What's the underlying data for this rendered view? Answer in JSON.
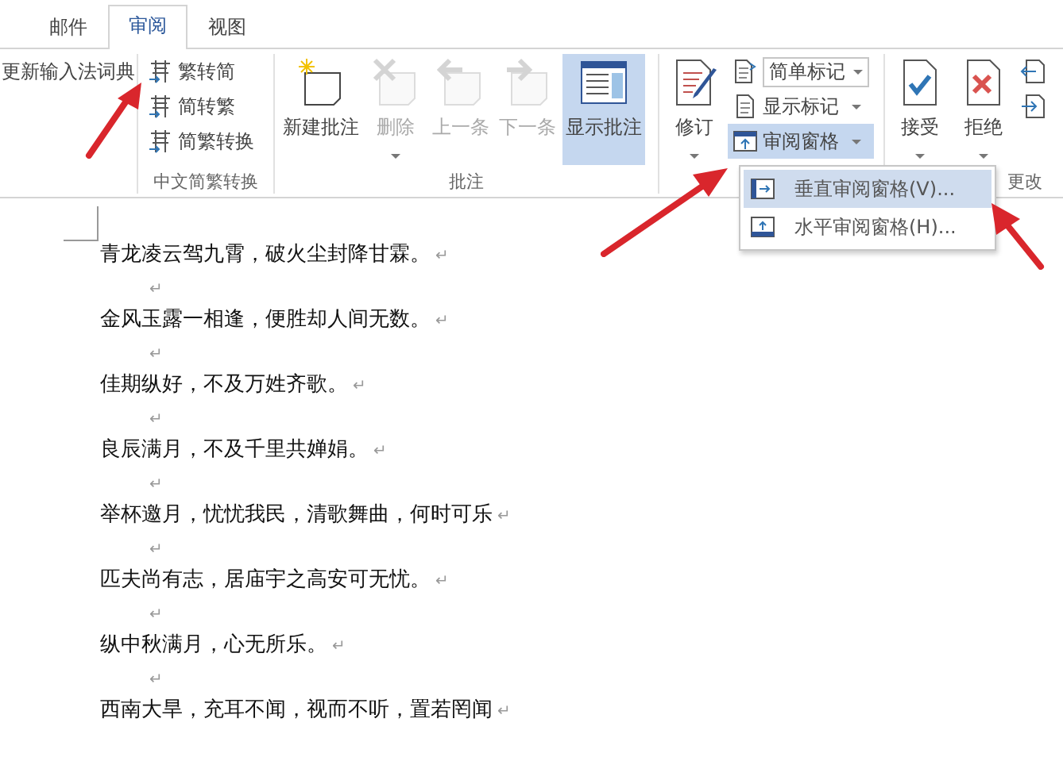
{
  "tabs": [
    {
      "label": "邮件",
      "selected": false
    },
    {
      "label": "审阅",
      "selected": true
    },
    {
      "label": "视图",
      "selected": false
    }
  ],
  "ribbon": {
    "groups": [
      {
        "items": [
          {
            "kind": "small",
            "label": "更新输入法词典",
            "disabled": false,
            "selected": false
          }
        ]
      },
      {
        "label": "中文简繁转换",
        "items": [
          {
            "kind": "small",
            "label": "繁转简",
            "disabled": false,
            "selected": false
          },
          {
            "kind": "small",
            "label": "简转繁",
            "disabled": false,
            "selected": false
          },
          {
            "kind": "small",
            "label": "简繁转换",
            "disabled": false,
            "selected": false
          }
        ]
      },
      {
        "label": "批注",
        "items": [
          {
            "kind": "large",
            "label": "新建批注",
            "disabled": false,
            "selected": false
          },
          {
            "kind": "large",
            "label": "删除",
            "disabled": true,
            "selected": false,
            "dropdown": true
          },
          {
            "kind": "large",
            "label": "上一条",
            "disabled": true,
            "selected": false
          },
          {
            "kind": "large",
            "label": "下一条",
            "disabled": true,
            "selected": false
          },
          {
            "kind": "large",
            "label": "显示批注",
            "disabled": false,
            "selected": true
          }
        ]
      },
      {
        "items": [
          {
            "kind": "large",
            "label": "修订",
            "disabled": false,
            "selected": false,
            "dropdown": true
          },
          {
            "kind": "combo",
            "label": "简单标记",
            "dropdown": true
          },
          {
            "kind": "small",
            "label": "显示标记",
            "disabled": false,
            "selected": false,
            "dropdown": true
          },
          {
            "kind": "small",
            "label": "审阅窗格",
            "disabled": false,
            "selected": true,
            "dropdown": true
          }
        ]
      },
      {
        "label": "更改",
        "items": [
          {
            "kind": "large",
            "label": "接受",
            "disabled": false,
            "selected": false,
            "dropdown": true
          },
          {
            "kind": "large",
            "label": "拒绝",
            "disabled": false,
            "selected": false,
            "dropdown": true
          },
          {
            "kind": "icon",
            "disabled": false,
            "selected": false
          },
          {
            "kind": "icon",
            "disabled": false,
            "selected": false
          }
        ]
      }
    ]
  },
  "menu": {
    "items": [
      {
        "label": "垂直审阅窗格(V)...",
        "selected": true
      },
      {
        "label": "水平审阅窗格(H)...",
        "selected": false
      }
    ]
  },
  "document": {
    "lines": [
      "青龙凌云驾九霄，破火尘封降甘霖。↵",
      "↵",
      "金风玉露一相逢，便胜却人间无数。↵",
      "↵",
      "佳期纵好，不及万姓齐歌。↵",
      "↵",
      "良辰满月，不及千里共婵娟。↵",
      "↵",
      "举杯邀月，忧忧我民，清歌舞曲，何时可乐↵",
      "↵",
      "匹夫尚有志，居庙宇之高安可无忧。↵",
      "↵",
      "纵中秋满月，心无所乐。↵",
      "↵",
      "西南大旱，充耳不闻，视而不听，置若罔闻↵"
    ]
  }
}
